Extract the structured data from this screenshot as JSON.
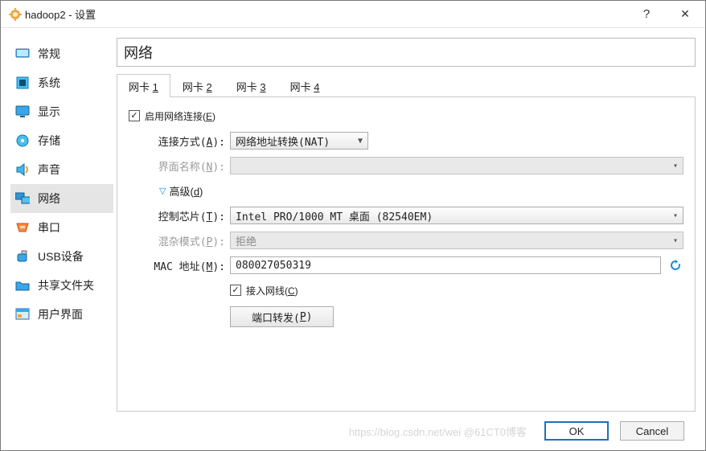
{
  "window": {
    "title": "hadoop2 - 设置",
    "help": "?",
    "close": "✕"
  },
  "sidebar": {
    "items": [
      {
        "label": "常规"
      },
      {
        "label": "系统"
      },
      {
        "label": "显示"
      },
      {
        "label": "存储"
      },
      {
        "label": "声音"
      },
      {
        "label": "网络"
      },
      {
        "label": "串口"
      },
      {
        "label": "USB设备"
      },
      {
        "label": "共享文件夹"
      },
      {
        "label": "用户界面"
      }
    ],
    "selected": 5
  },
  "page": {
    "title": "网络"
  },
  "tabs": {
    "prefix": "网卡 ",
    "items": [
      "1",
      "2",
      "3",
      "4"
    ],
    "active": 0
  },
  "form": {
    "enable": {
      "checked": true,
      "label": "启用网络连接(",
      "key": "E",
      "tail": ")"
    },
    "attach": {
      "label": "连接方式(",
      "key": "A",
      "tail": "):",
      "value": "网络地址转换(NAT)"
    },
    "ifname": {
      "label": "界面名称(",
      "key": "N",
      "tail": "):"
    },
    "advanced": {
      "label": "高级(",
      "key": "d",
      "tail": ")"
    },
    "chip": {
      "label": "控制芯片(",
      "key": "T",
      "tail": "):",
      "value": "Intel PRO/1000 MT 桌面 (82540EM)"
    },
    "promisc": {
      "label": "混杂模式(",
      "key": "P",
      "tail": "):",
      "value": "拒绝"
    },
    "mac": {
      "label": "MAC 地址(",
      "key": "M",
      "tail": "):",
      "value": "080027050319"
    },
    "cable": {
      "checked": true,
      "label": "接入网线(",
      "key": "C",
      "tail": ")"
    },
    "portfwd": {
      "label": "端口转发(",
      "key": "P",
      "tail": ")"
    }
  },
  "footer": {
    "ok": "OK",
    "cancel": "Cancel",
    "watermark": "https://blog.csdn.net/wei @61CT0博客"
  }
}
